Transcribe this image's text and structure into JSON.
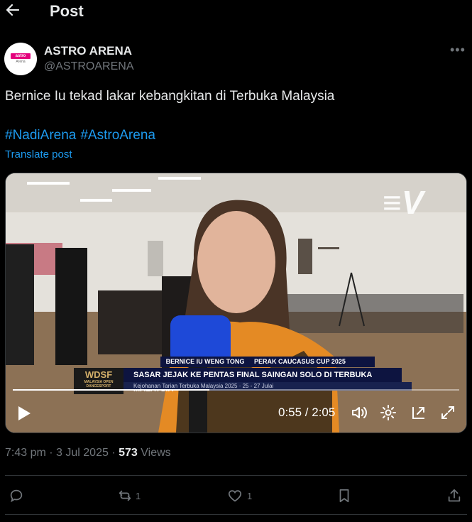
{
  "header": {
    "title": "Post"
  },
  "author": {
    "display_name": "ASTRO ARENA",
    "handle": "@ASTROARENA",
    "avatar_line1": "astro",
    "avatar_line2": "Arena"
  },
  "post": {
    "text": "Bernice Iu tekad lakar kebangkitan di Terbuka Malaysia",
    "hashtags": [
      "#NadiArena",
      "#AstroArena"
    ],
    "translate_label": "Translate post"
  },
  "video": {
    "brand_mark": "≡V",
    "lower_name": "BERNICE IU WENG TONG",
    "lower_event": "PERAK CAUCASUS CUP 2025",
    "lower_logo": "WDSF",
    "lower_logo_sub": "MALAYSIA OPEN DANCESPORT",
    "lower_headline": "SASAR JEJAK KE PENTAS FINAL SAINGAN SOLO DI TERBUKA MALAYSIA",
    "lower_sub": "Kejohanan Tarian Terbuka Malaysia 2025 · 25 - 27 Julai",
    "time_display": "0:55 / 2:05",
    "progress": 0.44
  },
  "meta": {
    "time": "7:43 pm",
    "date": "3 Jul 2025",
    "views_count": "573",
    "views_label": "Views"
  },
  "actions": {
    "replies": "",
    "reposts": "1",
    "likes": "1"
  }
}
